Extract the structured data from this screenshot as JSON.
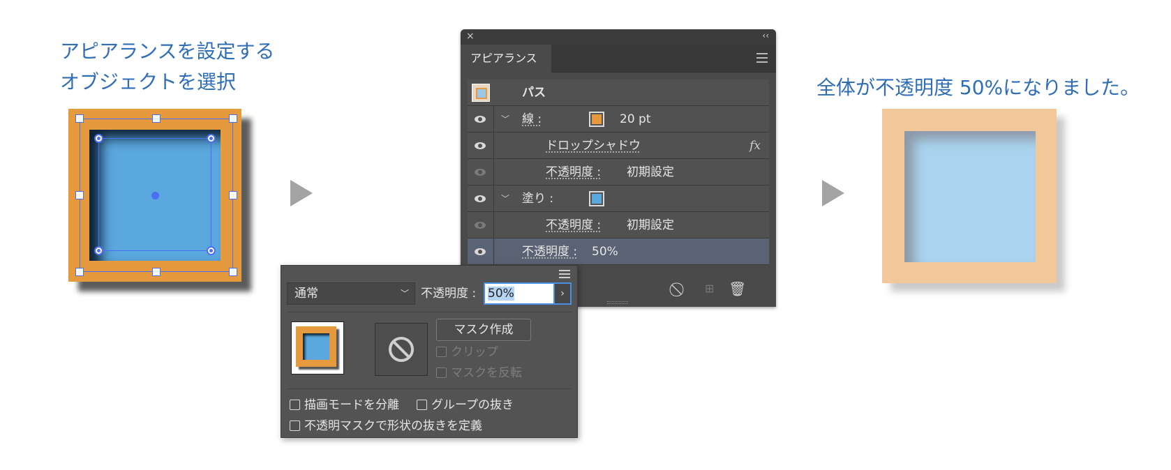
{
  "left_caption": {
    "line1": "アピアランスを設定する",
    "line2": "オブジェクトを選択"
  },
  "right_caption": "全体が不透明度 50%になりました。",
  "colors": {
    "caption": "#2f6db5",
    "stroke_orange": "#e49a3d",
    "fill_blue": "#5ba8de",
    "result_outer": "#f2c89a",
    "result_inner": "#a9d3ee",
    "selection": "#4b6ef5"
  },
  "appearance_panel": {
    "close_glyph": "×",
    "collapse_glyph": "‹‹",
    "tab_label": "アピアランス",
    "object_type": "パス",
    "rows": {
      "stroke_label": "線 :",
      "stroke_weight": "20 pt",
      "drop_shadow_label": "ドロップシャドウ",
      "fx_label": "fx",
      "stroke_opacity_label": "不透明度 :",
      "stroke_opacity_value": "初期設定",
      "fill_label": "塗り :",
      "fill_opacity_label": "不透明度 :",
      "fill_opacity_value": "初期設定",
      "object_opacity_label": "不透明度 :",
      "object_opacity_value": "50%"
    },
    "footer_icons": [
      "clear-appearance-icon",
      "add-new-item-icon",
      "trash-icon"
    ]
  },
  "transparency_popup": {
    "blend_mode": "通常",
    "opacity_label": "不透明度 :",
    "opacity_value": "50%",
    "make_mask_button": "マスク作成",
    "clip_label": "クリップ",
    "invert_mask_label": "マスクを反転",
    "isolate_blending_label": "描画モードを分離",
    "knockout_group_label": "グループの抜き",
    "opacity_mask_knockout_label": "不透明マスクで形状の抜きを定義"
  }
}
